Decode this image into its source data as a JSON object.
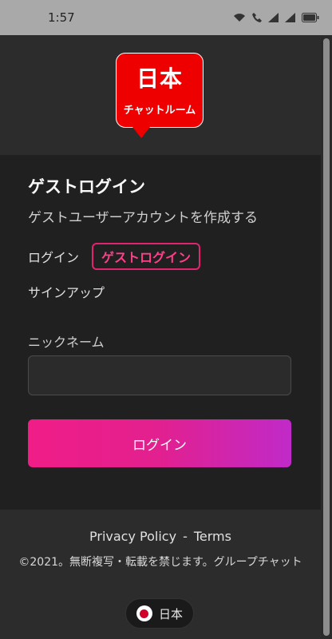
{
  "status_bar": {
    "time": "1:57"
  },
  "header": {
    "logo_main": "日本",
    "logo_sub": "チャットルーム"
  },
  "main": {
    "title": "ゲストログイン",
    "subtitle": "ゲストユーザーアカウントを作成する",
    "tabs": {
      "login": "ログイン",
      "guest_login": "ゲストログイン",
      "signup": "サインアップ"
    },
    "nickname_label": "ニックネーム",
    "nickname_value": "",
    "login_button": "ログイン"
  },
  "footer": {
    "privacy_link": "Privacy Policy",
    "separator": "-",
    "terms_link": "Terms",
    "copyright": "©2021。無断複写・転載を禁じます。グループチャット",
    "language": "日本"
  },
  "colors": {
    "accent": "#e2246e",
    "logo_red": "#ee0000",
    "button_gradient_start": "#f01d87",
    "button_gradient_end": "#c02ac8"
  }
}
